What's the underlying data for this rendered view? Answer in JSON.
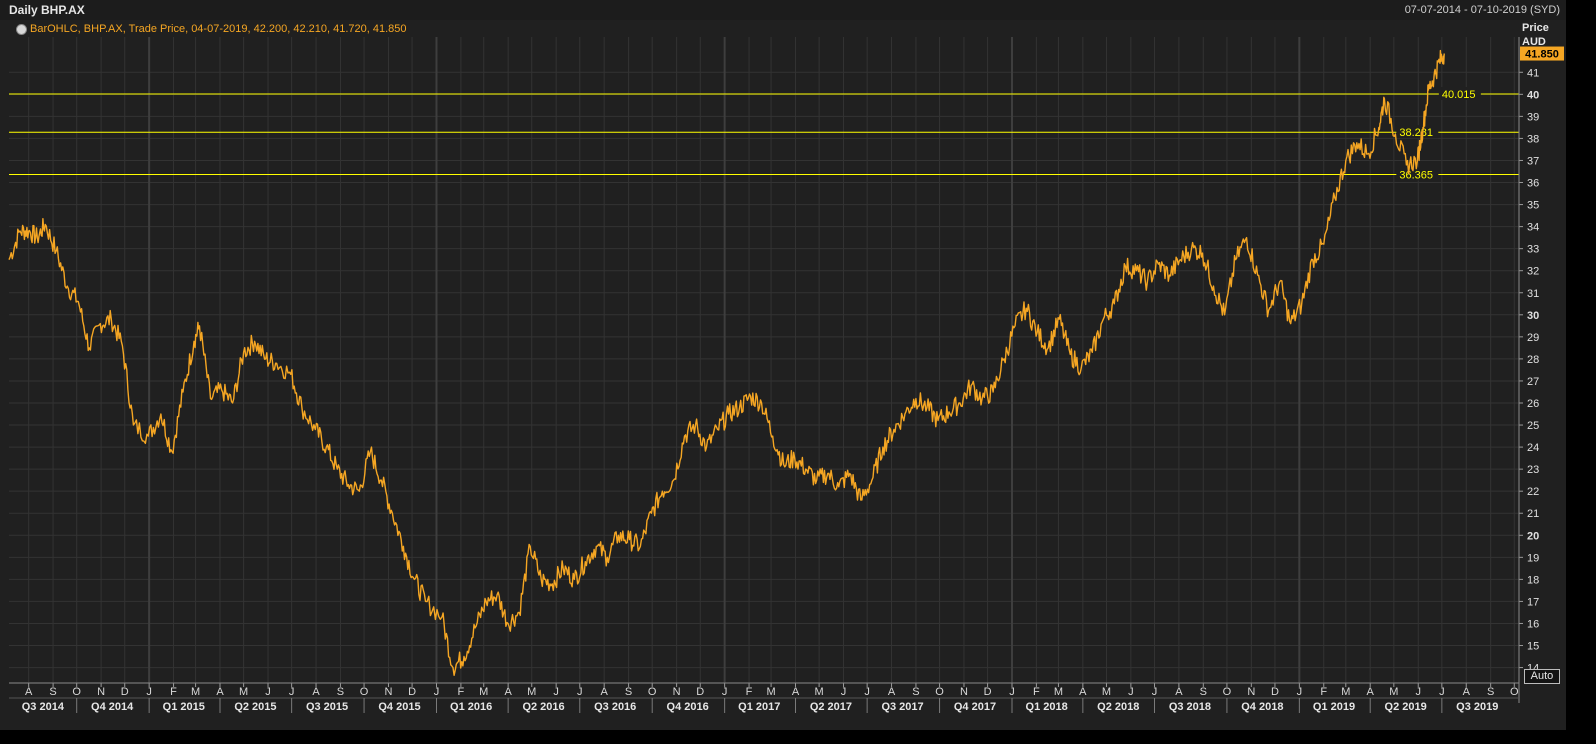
{
  "header": {
    "title": "Daily BHP.AX",
    "date_range": "07-07-2014 - 07-10-2019 (SYD)"
  },
  "legend": {
    "icon": "clock-icon",
    "text": "BarOHLC, BHP.AX, Trade Price, 04-07-2019, 42.200, 42.210, 41.720, 41.850"
  },
  "price_axis": {
    "title_line1": "Price",
    "title_line2": "AUD",
    "last_price": "41.850"
  },
  "auto_button": "Auto",
  "colors": {
    "background": "#202020",
    "series": "#f5a623",
    "level_line": "#ffff00",
    "last_price_badge": "#f5a623"
  },
  "chart_data": {
    "type": "line",
    "title": "Daily BHP.AX",
    "series": [
      {
        "name": "BHP.AX",
        "points": [
          [
            "2014-07-07",
            32.5
          ],
          [
            "2014-07-21",
            33.8
          ],
          [
            "2014-08-01",
            33.8
          ],
          [
            "2014-08-12",
            33.5
          ],
          [
            "2014-08-22",
            34.1
          ],
          [
            "2014-09-05",
            32.9
          ],
          [
            "2014-09-19",
            31.3
          ],
          [
            "2014-10-03",
            30.6
          ],
          [
            "2014-10-17",
            28.5
          ],
          [
            "2014-10-31",
            29.6
          ],
          [
            "2014-11-14",
            29.8
          ],
          [
            "2014-11-28",
            28.6
          ],
          [
            "2014-12-12",
            25.0
          ],
          [
            "2014-12-31",
            24.5
          ],
          [
            "2015-01-16",
            25.5
          ],
          [
            "2015-01-30",
            23.8
          ],
          [
            "2015-02-13",
            26.5
          ],
          [
            "2015-02-27",
            28.8
          ],
          [
            "2015-03-06",
            29.5
          ],
          [
            "2015-03-20",
            26.2
          ],
          [
            "2015-04-03",
            26.6
          ],
          [
            "2015-04-17",
            26.0
          ],
          [
            "2015-05-01",
            28.3
          ],
          [
            "2015-05-15",
            28.8
          ],
          [
            "2015-05-29",
            28.0
          ],
          [
            "2015-06-12",
            27.8
          ],
          [
            "2015-06-30",
            27.3
          ],
          [
            "2015-07-14",
            25.8
          ],
          [
            "2015-07-31",
            24.8
          ],
          [
            "2015-08-14",
            24.0
          ],
          [
            "2015-08-28",
            23.0
          ],
          [
            "2015-09-11",
            22.3
          ],
          [
            "2015-09-25",
            22.0
          ],
          [
            "2015-10-09",
            23.8
          ],
          [
            "2015-10-23",
            22.5
          ],
          [
            "2015-11-06",
            21.0
          ],
          [
            "2015-11-20",
            19.5
          ],
          [
            "2015-12-04",
            18.0
          ],
          [
            "2015-12-18",
            17.0
          ],
          [
            "2016-01-08",
            16.3
          ],
          [
            "2016-01-22",
            14.0
          ],
          [
            "2016-02-05",
            14.5
          ],
          [
            "2016-02-19",
            15.8
          ],
          [
            "2016-03-04",
            17.0
          ],
          [
            "2016-03-18",
            17.3
          ],
          [
            "2016-04-01",
            16.0
          ],
          [
            "2016-04-15",
            16.5
          ],
          [
            "2016-04-29",
            19.5
          ],
          [
            "2016-05-13",
            18.0
          ],
          [
            "2016-05-27",
            17.8
          ],
          [
            "2016-06-10",
            18.5
          ],
          [
            "2016-06-24",
            18.0
          ],
          [
            "2016-07-08",
            18.8
          ],
          [
            "2016-07-22",
            19.5
          ],
          [
            "2016-08-05",
            19.0
          ],
          [
            "2016-08-19",
            20.0
          ],
          [
            "2016-09-02",
            19.8
          ],
          [
            "2016-09-16",
            19.5
          ],
          [
            "2016-09-30",
            21.0
          ],
          [
            "2016-10-14",
            22.0
          ],
          [
            "2016-10-28",
            22.5
          ],
          [
            "2016-11-11",
            24.5
          ],
          [
            "2016-11-25",
            25.0
          ],
          [
            "2016-12-09",
            24.0
          ],
          [
            "2016-12-23",
            24.8
          ],
          [
            "2017-01-06",
            25.5
          ],
          [
            "2017-01-20",
            25.8
          ],
          [
            "2017-02-03",
            26.3
          ],
          [
            "2017-02-17",
            26.0
          ],
          [
            "2017-03-03",
            24.5
          ],
          [
            "2017-03-17",
            23.2
          ],
          [
            "2017-03-31",
            23.5
          ],
          [
            "2017-04-14",
            23.0
          ],
          [
            "2017-04-28",
            22.5
          ],
          [
            "2017-05-12",
            22.8
          ],
          [
            "2017-05-26",
            22.2
          ],
          [
            "2017-06-09",
            22.8
          ],
          [
            "2017-06-23",
            21.6
          ],
          [
            "2017-07-07",
            22.5
          ],
          [
            "2017-07-21",
            24.0
          ],
          [
            "2017-08-04",
            24.8
          ],
          [
            "2017-08-18",
            25.5
          ],
          [
            "2017-09-01",
            26.2
          ],
          [
            "2017-09-15",
            25.8
          ],
          [
            "2017-09-29",
            25.2
          ],
          [
            "2017-10-13",
            25.6
          ],
          [
            "2017-10-27",
            26.0
          ],
          [
            "2017-11-10",
            26.8
          ],
          [
            "2017-11-24",
            26.2
          ],
          [
            "2017-12-08",
            26.5
          ],
          [
            "2017-12-22",
            28.0
          ],
          [
            "2018-01-05",
            29.5
          ],
          [
            "2018-01-19",
            30.3
          ],
          [
            "2018-02-02",
            29.2
          ],
          [
            "2018-02-16",
            28.5
          ],
          [
            "2018-03-02",
            29.8
          ],
          [
            "2018-03-16",
            28.2
          ],
          [
            "2018-03-30",
            27.6
          ],
          [
            "2018-04-13",
            28.3
          ],
          [
            "2018-04-27",
            29.8
          ],
          [
            "2018-05-11",
            30.5
          ],
          [
            "2018-05-25",
            32.2
          ],
          [
            "2018-06-08",
            32.0
          ],
          [
            "2018-06-22",
            31.5
          ],
          [
            "2018-07-06",
            32.3
          ],
          [
            "2018-07-20",
            31.8
          ],
          [
            "2018-08-03",
            32.5
          ],
          [
            "2018-08-17",
            33.0
          ],
          [
            "2018-08-31",
            32.8
          ],
          [
            "2018-09-14",
            31.3
          ],
          [
            "2018-09-28",
            30.0
          ],
          [
            "2018-10-12",
            32.5
          ],
          [
            "2018-10-26",
            33.5
          ],
          [
            "2018-11-09",
            31.8
          ],
          [
            "2018-11-23",
            30.2
          ],
          [
            "2018-12-07",
            31.5
          ],
          [
            "2018-12-21",
            29.6
          ],
          [
            "2019-01-04",
            30.5
          ],
          [
            "2019-01-18",
            32.5
          ],
          [
            "2019-02-01",
            33.2
          ],
          [
            "2019-02-15",
            35.3
          ],
          [
            "2019-03-01",
            37.0
          ],
          [
            "2019-03-15",
            37.8
          ],
          [
            "2019-03-29",
            37.3
          ],
          [
            "2019-04-12",
            38.5
          ],
          [
            "2019-04-19",
            39.8
          ],
          [
            "2019-05-03",
            38.2
          ],
          [
            "2019-05-17",
            36.8
          ],
          [
            "2019-05-31",
            37.0
          ],
          [
            "2019-06-07",
            38.5
          ],
          [
            "2019-06-14",
            40.2
          ],
          [
            "2019-06-21",
            40.8
          ],
          [
            "2019-06-28",
            41.5
          ],
          [
            "2019-07-04",
            41.85
          ]
        ]
      }
    ],
    "y_axis": {
      "range": [
        13.3,
        42.6
      ],
      "ticks": [
        14,
        15,
        16,
        17,
        18,
        19,
        20,
        21,
        22,
        23,
        24,
        25,
        26,
        27,
        28,
        29,
        30,
        31,
        32,
        33,
        34,
        35,
        36,
        37,
        38,
        39,
        40,
        41
      ],
      "bold_ticks": [
        20,
        30,
        40
      ]
    },
    "x_axis": {
      "range": [
        "2014-07-07",
        "2019-10-07"
      ],
      "month_ticks": [
        [
          "2014-08-01",
          "A"
        ],
        [
          "2014-09-01",
          "S"
        ],
        [
          "2014-10-01",
          "O"
        ],
        [
          "2014-11-01",
          "N"
        ],
        [
          "2014-12-01",
          "D"
        ],
        [
          "2015-01-01",
          "J"
        ],
        [
          "2015-02-01",
          "F"
        ],
        [
          "2015-03-01",
          "M"
        ],
        [
          "2015-04-01",
          "A"
        ],
        [
          "2015-05-01",
          "M"
        ],
        [
          "2015-06-01",
          "J"
        ],
        [
          "2015-07-01",
          "J"
        ],
        [
          "2015-08-01",
          "A"
        ],
        [
          "2015-09-01",
          "S"
        ],
        [
          "2015-10-01",
          "O"
        ],
        [
          "2015-11-01",
          "N"
        ],
        [
          "2015-12-01",
          "D"
        ],
        [
          "2016-01-01",
          "J"
        ],
        [
          "2016-02-01",
          "F"
        ],
        [
          "2016-03-01",
          "M"
        ],
        [
          "2016-04-01",
          "A"
        ],
        [
          "2016-05-01",
          "M"
        ],
        [
          "2016-06-01",
          "J"
        ],
        [
          "2016-07-01",
          "J"
        ],
        [
          "2016-08-01",
          "A"
        ],
        [
          "2016-09-01",
          "S"
        ],
        [
          "2016-10-01",
          "O"
        ],
        [
          "2016-11-01",
          "N"
        ],
        [
          "2016-12-01",
          "D"
        ],
        [
          "2017-01-01",
          "J"
        ],
        [
          "2017-02-01",
          "F"
        ],
        [
          "2017-03-01",
          "M"
        ],
        [
          "2017-04-01",
          "A"
        ],
        [
          "2017-05-01",
          "M"
        ],
        [
          "2017-06-01",
          "J"
        ],
        [
          "2017-07-01",
          "J"
        ],
        [
          "2017-08-01",
          "A"
        ],
        [
          "2017-09-01",
          "S"
        ],
        [
          "2017-10-01",
          "O"
        ],
        [
          "2017-11-01",
          "N"
        ],
        [
          "2017-12-01",
          "D"
        ],
        [
          "2018-01-01",
          "J"
        ],
        [
          "2018-02-01",
          "F"
        ],
        [
          "2018-03-01",
          "M"
        ],
        [
          "2018-04-01",
          "A"
        ],
        [
          "2018-05-01",
          "M"
        ],
        [
          "2018-06-01",
          "J"
        ],
        [
          "2018-07-01",
          "J"
        ],
        [
          "2018-08-01",
          "A"
        ],
        [
          "2018-09-01",
          "S"
        ],
        [
          "2018-10-01",
          "O"
        ],
        [
          "2018-11-01",
          "N"
        ],
        [
          "2018-12-01",
          "D"
        ],
        [
          "2019-01-01",
          "J"
        ],
        [
          "2019-02-01",
          "F"
        ],
        [
          "2019-03-01",
          "M"
        ],
        [
          "2019-04-01",
          "A"
        ],
        [
          "2019-05-01",
          "M"
        ],
        [
          "2019-06-01",
          "J"
        ],
        [
          "2019-07-01",
          "J"
        ],
        [
          "2019-08-01",
          "A"
        ],
        [
          "2019-09-01",
          "S"
        ],
        [
          "2019-10-01",
          "O"
        ]
      ],
      "quarter_labels": [
        [
          "2014-08-19",
          "Q3 2014"
        ],
        [
          "2014-11-15",
          "Q4 2014"
        ],
        [
          "2015-02-14",
          "Q1 2015"
        ],
        [
          "2015-05-16",
          "Q2 2015"
        ],
        [
          "2015-08-15",
          "Q3 2015"
        ],
        [
          "2015-11-15",
          "Q4 2015"
        ],
        [
          "2016-02-14",
          "Q1 2016"
        ],
        [
          "2016-05-16",
          "Q2 2016"
        ],
        [
          "2016-08-15",
          "Q3 2016"
        ],
        [
          "2016-11-15",
          "Q4 2016"
        ],
        [
          "2017-02-14",
          "Q1 2017"
        ],
        [
          "2017-05-16",
          "Q2 2017"
        ],
        [
          "2017-08-15",
          "Q3 2017"
        ],
        [
          "2017-11-15",
          "Q4 2017"
        ],
        [
          "2018-02-14",
          "Q1 2018"
        ],
        [
          "2018-05-16",
          "Q2 2018"
        ],
        [
          "2018-08-15",
          "Q3 2018"
        ],
        [
          "2018-11-15",
          "Q4 2018"
        ],
        [
          "2019-02-14",
          "Q1 2019"
        ],
        [
          "2019-05-16",
          "Q2 2019"
        ],
        [
          "2019-08-15",
          "Q3 2019"
        ]
      ],
      "year_separators": [
        "2015-01-01",
        "2016-01-01",
        "2017-01-01",
        "2018-01-01",
        "2019-01-01"
      ]
    },
    "horizontal_lines": [
      {
        "value": 40.015,
        "label": "40.015",
        "label_date": "2019-07-01"
      },
      {
        "value": 38.281,
        "label": "38.281",
        "label_date": "2019-05-08"
      },
      {
        "value": 36.365,
        "label": "36.365",
        "label_date": "2019-05-08"
      }
    ],
    "grid": true
  }
}
